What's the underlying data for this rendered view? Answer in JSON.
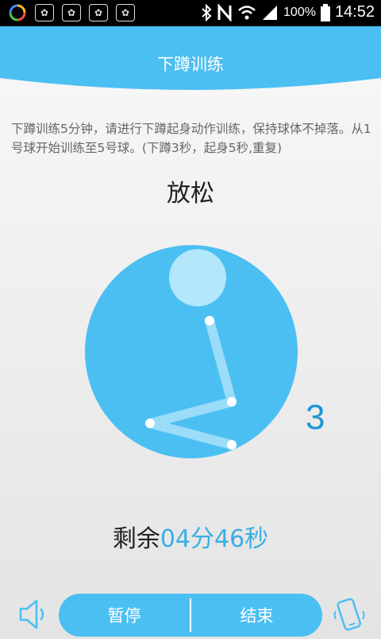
{
  "status_bar": {
    "bluetooth_icon": "bluetooth-icon",
    "nfc_icon": "nfc-icon",
    "wifi_icon": "wifi-icon",
    "signal_icon": "signal-icon",
    "battery_percent": "100%",
    "time": "14:52"
  },
  "header": {
    "title": "下蹲训练",
    "color": "#4cbff2"
  },
  "instructions": "下蹲训练5分钟，请进行下蹲起身动作训练，保持球体不掉落。从1号球开始训练至5号球。(下蹲3秒，起身5秒,重复)",
  "exercise": {
    "state": "放松",
    "count": "3",
    "figure_icon": "squat-figure-icon"
  },
  "timer": {
    "label": "剩余",
    "value": "04分46秒"
  },
  "controls": {
    "pause_label": "暂停",
    "end_label": "结束",
    "sound_icon": "speaker-icon",
    "vibrate_icon": "phone-vibrate-icon"
  }
}
